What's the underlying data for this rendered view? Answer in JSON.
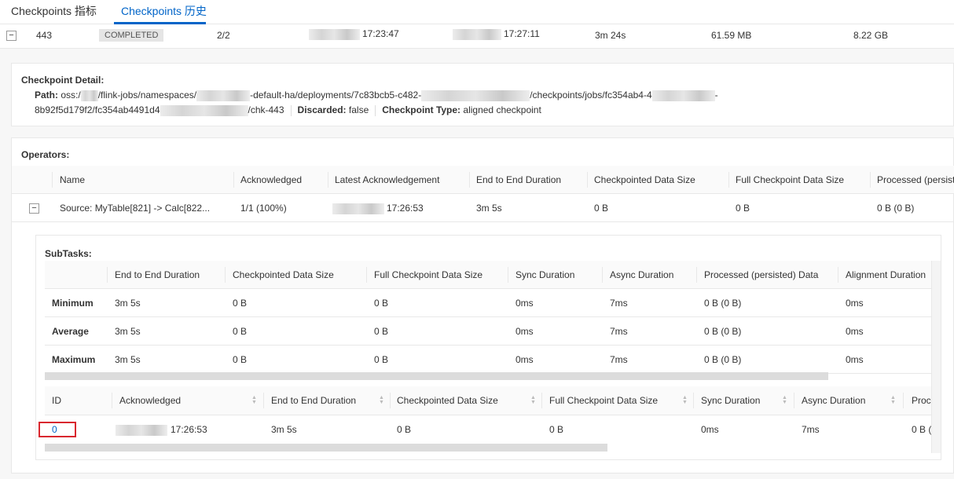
{
  "tabs": [
    {
      "label": "Checkpoints 指标",
      "active": false
    },
    {
      "label": "Checkpoints 历史",
      "active": true
    }
  ],
  "checkpoint_row": {
    "id": "443",
    "status": "COMPLETED",
    "acknowledged": "2/2",
    "trigger_time": "17:23:47",
    "latest_ack": "17:27:11",
    "duration": "3m 24s",
    "checkpointed_size": "61.59 MB",
    "full_size": "8.22 GB"
  },
  "detail": {
    "title": "Checkpoint Detail:",
    "path_label": "Path:",
    "path_p1": "oss:/",
    "path_p2": "/flink-jobs/namespaces/",
    "path_p3": "-default-ha/deployments/7c83bcb5-c482-",
    "path_p4": "/checkpoints/jobs/fc354ab4-4",
    "path_p5": "-",
    "path_p6": "8b92f5d179f2/fc354ab4491d4",
    "path_p7": "/chk-443",
    "discarded_label": "Discarded:",
    "discarded": "false",
    "type_label": "Checkpoint Type:",
    "type": "aligned checkpoint"
  },
  "operators": {
    "title": "Operators:",
    "headers": [
      "Name",
      "Acknowledged",
      "Latest Acknowledgement",
      "End to End Duration",
      "Checkpointed Data Size",
      "Full Checkpoint Data Size",
      "Processed (persiste"
    ],
    "row": [
      "Source: MyTable[821] -> Calc[822...",
      "1/1 (100%)",
      "17:26:53",
      "3m 5s",
      "0 B",
      "0 B",
      "0 B (0 B)"
    ]
  },
  "subtasks": {
    "title": "SubTasks:",
    "summary_headers": [
      "",
      "End to End Duration",
      "Checkpointed Data Size",
      "Full Checkpoint Data Size",
      "Sync Duration",
      "Async Duration",
      "Processed (persisted) Data",
      "Alignment Duration"
    ],
    "summary_rows": [
      [
        "Minimum",
        "3m 5s",
        "0 B",
        "0 B",
        "0ms",
        "7ms",
        "0 B (0 B)",
        "0ms"
      ],
      [
        "Average",
        "3m 5s",
        "0 B",
        "0 B",
        "0ms",
        "7ms",
        "0 B (0 B)",
        "0ms"
      ],
      [
        "Maximum",
        "3m 5s",
        "0 B",
        "0 B",
        "0ms",
        "7ms",
        "0 B (0 B)",
        "0ms"
      ]
    ],
    "detail_headers": [
      "ID",
      "Acknowledged",
      "End to End Duration",
      "Checkpointed Data Size",
      "Full Checkpoint Data Size",
      "Sync Duration",
      "Async Duration",
      "Proce"
    ],
    "detail_row": [
      "0",
      "17:26:53",
      "3m 5s",
      "0 B",
      "0 B",
      "0ms",
      "7ms",
      "0 B (0"
    ]
  },
  "colors": {
    "accent": "#0064c8",
    "highlight_box": "#d9272e"
  }
}
